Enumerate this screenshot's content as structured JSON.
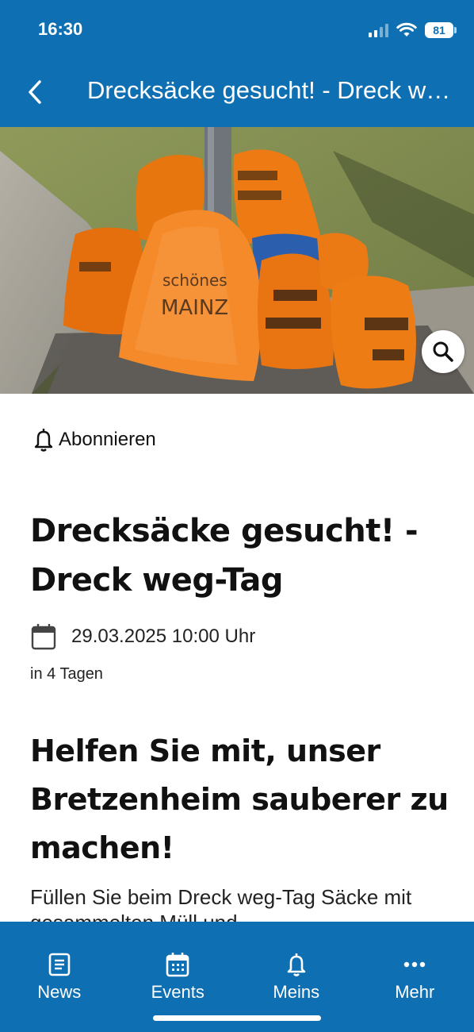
{
  "status_bar": {
    "time": "16:30",
    "battery": "81"
  },
  "app_bar": {
    "title": "Drecksäcke gesucht! - Dreck weg-Tag"
  },
  "hero": {
    "bag_text_line1": "schönes",
    "bag_text_line2": "MAINZ"
  },
  "subscribe": {
    "label": "Abonnieren"
  },
  "event": {
    "title": "Drecksäcke gesucht! - Dreck weg-Tag",
    "date": "29.03.2025 10:00 Uhr",
    "relative": "in 4 Tagen",
    "heading": "Helfen Sie mit, unser Bretzenheim sauberer zu machen!",
    "body": "Füllen Sie beim Dreck weg-Tag Säcke mit gesammelten Müll und"
  },
  "bottom_nav": {
    "items": [
      {
        "label": "News",
        "icon": "news-icon"
      },
      {
        "label": "Events",
        "icon": "calendar-icon"
      },
      {
        "label": "Meins",
        "icon": "bell-icon"
      },
      {
        "label": "Mehr",
        "icon": "more-dots-icon"
      }
    ]
  },
  "colors": {
    "primary": "#0f6fb3",
    "bag_orange": "#f07a12"
  }
}
